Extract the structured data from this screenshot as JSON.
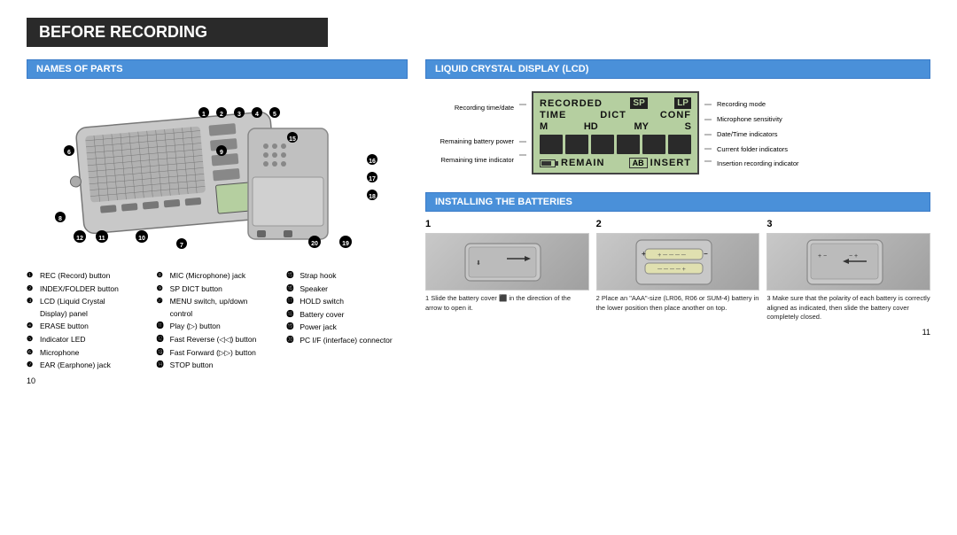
{
  "title": "BEFORE RECORDING",
  "sections": {
    "names_of_parts": {
      "header": "NAMES OF PARTS",
      "parts": [
        {
          "num": "1",
          "text": "REC (Record) button"
        },
        {
          "num": "2",
          "text": "INDEX/FOLDER button"
        },
        {
          "num": "3",
          "text": "LCD (Liquid Crystal Display) panel"
        },
        {
          "num": "4",
          "text": "ERASE button"
        },
        {
          "num": "5",
          "text": "Indicator LED"
        },
        {
          "num": "6",
          "text": "Microphone"
        },
        {
          "num": "7",
          "text": "EAR (Earphone) jack"
        },
        {
          "num": "8",
          "text": "MIC (Microphone) jack"
        },
        {
          "num": "9",
          "text": "SP DICT button"
        },
        {
          "num": "10",
          "text": "MENU switch, up/down control"
        },
        {
          "num": "11",
          "text": "Play ( ) button"
        },
        {
          "num": "12",
          "text": "Fast Reverse (    ) button"
        },
        {
          "num": "13",
          "text": "Fast Forward (    ) button"
        },
        {
          "num": "14",
          "text": "STOP button"
        },
        {
          "num": "15",
          "text": "Strap hook"
        },
        {
          "num": "16",
          "text": "Speaker"
        },
        {
          "num": "17",
          "text": "HOLD switch"
        },
        {
          "num": "18",
          "text": "Battery cover"
        },
        {
          "num": "19",
          "text": "Power jack"
        },
        {
          "num": "20",
          "text": "PC I/F (interface) connector"
        }
      ]
    },
    "lcd": {
      "header": "LIQUID CRYSTAL DISPLAY (LCD)",
      "labels_left": [
        "Recording time/date",
        "Remaining battery power",
        "Remaining time indicator"
      ],
      "labels_right": [
        "Recording mode",
        "Microphone sensitivity",
        "Date/Time indicators",
        "Current folder indicators",
        "Insertion recording indicator"
      ],
      "display": {
        "row1": [
          "RECORDED",
          "SP",
          "LP"
        ],
        "row2": [
          "TIME",
          "DICT",
          "CONF"
        ],
        "row3": [
          "M",
          "HD",
          "MY",
          "S"
        ],
        "remain": "REMAIN",
        "insert": "INSERT"
      }
    },
    "batteries": {
      "header": "INSTALLING THE BATTERIES",
      "steps": [
        {
          "num": "1",
          "text": "Slide the battery cover  in the direction of the arrow to open it."
        },
        {
          "num": "2",
          "text": "Place an \"AAA\"-size (LR06, R06 or SUM-4) battery in the lower position then place another on top."
        },
        {
          "num": "3",
          "text": "Make sure that the polarity of each battery is correctly aligned as indicated, then slide the battery cover completely closed."
        }
      ]
    }
  },
  "page_numbers": {
    "left": "10",
    "right": "11"
  }
}
